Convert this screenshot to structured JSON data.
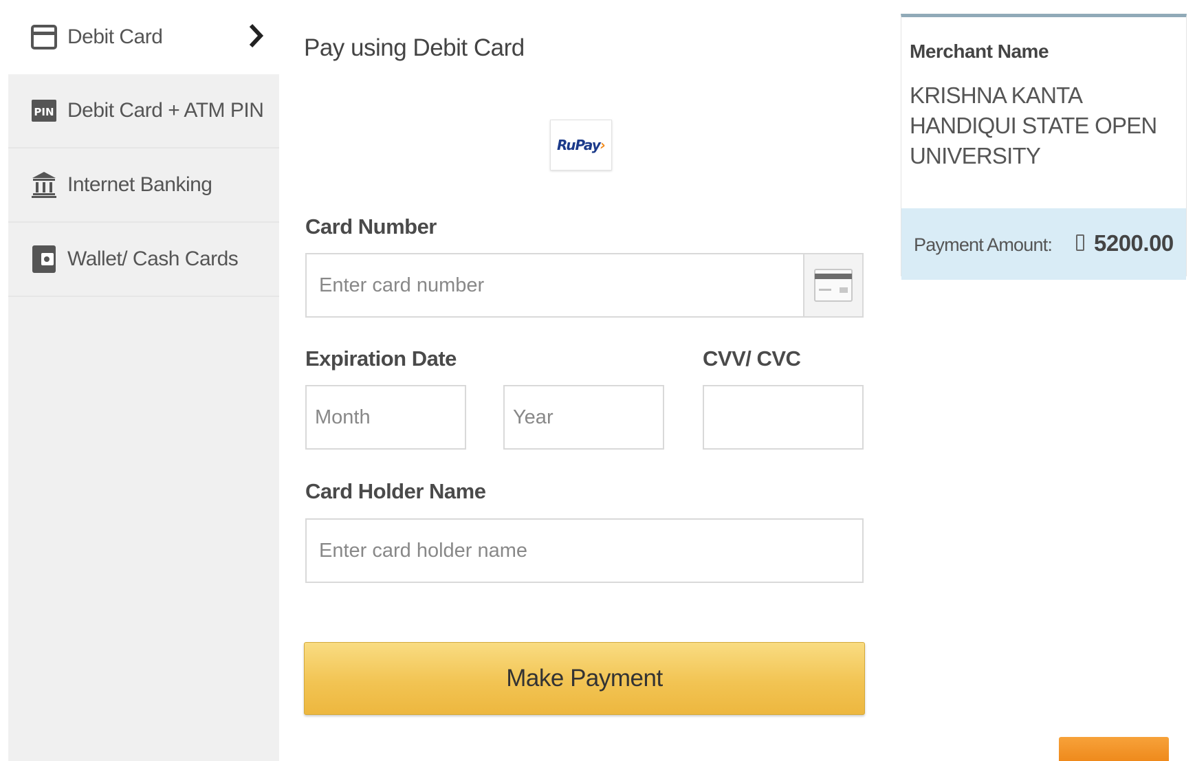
{
  "sidebar": {
    "items": [
      {
        "label": "Debit Card",
        "icon": "credit-card-icon",
        "active": true
      },
      {
        "label": "Debit Card + ATM PIN",
        "icon": "pin-icon",
        "active": false
      },
      {
        "label": "Internet Banking",
        "icon": "bank-icon",
        "active": false
      },
      {
        "label": "Wallet/ Cash Cards",
        "icon": "wallet-icon",
        "active": false
      }
    ],
    "pin_icon_text": "PIN"
  },
  "form": {
    "title": "Pay using Debit Card",
    "logo_text": "RuPay",
    "card_number": {
      "label": "Card Number",
      "placeholder": "Enter card number",
      "value": ""
    },
    "expiration": {
      "label": "Expiration Date",
      "month_placeholder": "Month",
      "year_placeholder": "Year"
    },
    "cvv": {
      "label": "CVV/ CVC",
      "placeholder": "",
      "value": ""
    },
    "holder": {
      "label": "Card Holder Name",
      "placeholder": "Enter card holder name",
      "value": ""
    },
    "submit_label": "Make Payment"
  },
  "merchant": {
    "label": "Merchant Name",
    "name": "KRISHNA KANTA HANDIQUI STATE OPEN UNIVERSITY",
    "amount_label": "Payment Amount:",
    "amount_value": "5200.00"
  },
  "colors": {
    "sidebar_bg": "#f0f0f0",
    "button_gold": "#f2c453",
    "amount_bar": "#d9ecf6",
    "merchant_border": "#90aab8",
    "orange_accent": "#ef8a1c"
  }
}
